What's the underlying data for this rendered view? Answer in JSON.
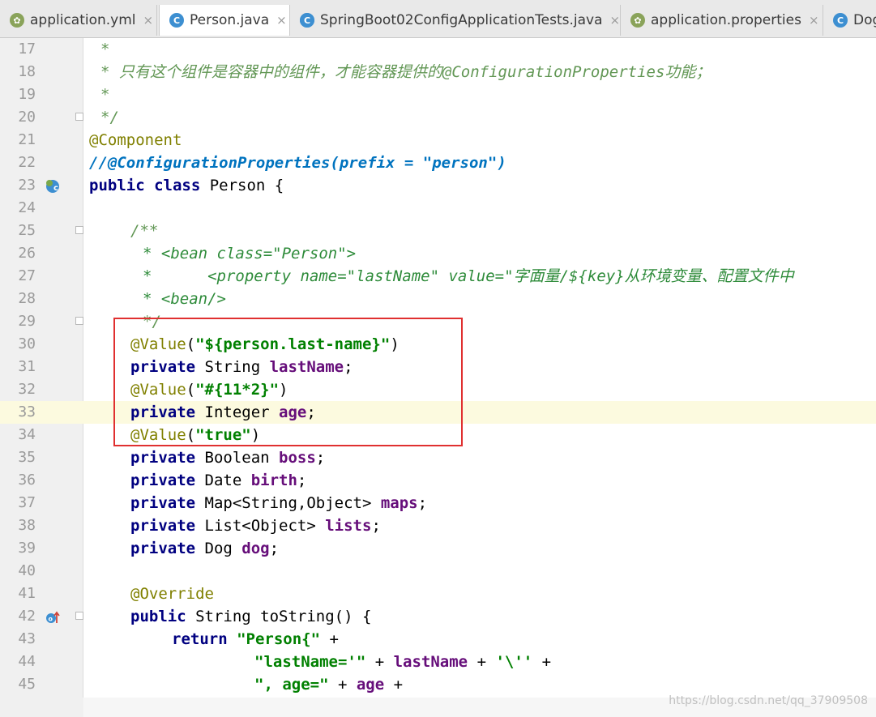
{
  "tabs": [
    {
      "label": "application.yml",
      "icon": "spring-leaf-icon"
    },
    {
      "label": "Person.java",
      "icon": "java-class-icon"
    },
    {
      "label": "SpringBoot02ConfigApplicationTests.java",
      "icon": "java-test-class-icon"
    },
    {
      "label": "application.properties",
      "icon": "spring-leaf-icon"
    },
    {
      "label": "Dog",
      "icon": "java-class-icon"
    }
  ],
  "tab_close_glyph": "×",
  "lines": {
    "17": "*",
    "18": "* 只有这个组件是容器中的组件，才能容器提供的@ConfigurationProperties功能；",
    "19": "*",
    "20": "*/",
    "21": "@Component",
    "22": "//@ConfigurationProperties(prefix = \"person\")",
    "23": "public class Person {",
    "24": "",
    "25": "/**",
    "26": "* <bean class=\"Person\">",
    "27": "*      <property name=\"lastName\" value=\"字面量/${key}从环境变量、配置文件中",
    "28": "* <bean/>",
    "29": "*/",
    "30": "@Value(\"${person.last-name}\")",
    "31": "private String lastName;",
    "32": "@Value(\"#{11*2}\")",
    "33": "private Integer age;",
    "34": "@Value(\"true\")",
    "35": "private Boolean boss;",
    "36": "private Date birth;",
    "37": "private Map<String,Object> maps;",
    "38": "private List<Object> lists;",
    "39": "private Dog dog;",
    "40": "",
    "41": "@Override",
    "42": "public String toString() {",
    "43": "return \"Person{\" +",
    "44": "\"lastName='\" + lastName + '\\'' +",
    "45": "\", age=\" + age +"
  },
  "line_numbers": [
    "17",
    "18",
    "19",
    "20",
    "21",
    "22",
    "23",
    "24",
    "25",
    "26",
    "27",
    "28",
    "29",
    "30",
    "31",
    "32",
    "33",
    "34",
    "35",
    "36",
    "37",
    "38",
    "39",
    "40",
    "41",
    "42",
    "43",
    "44",
    "45"
  ],
  "current_line": "33",
  "watermark": "https://blog.csdn.net/qq_37909508",
  "colors": {
    "highlight_box": "#e03030",
    "current_line_bg": "#fcfadf"
  }
}
